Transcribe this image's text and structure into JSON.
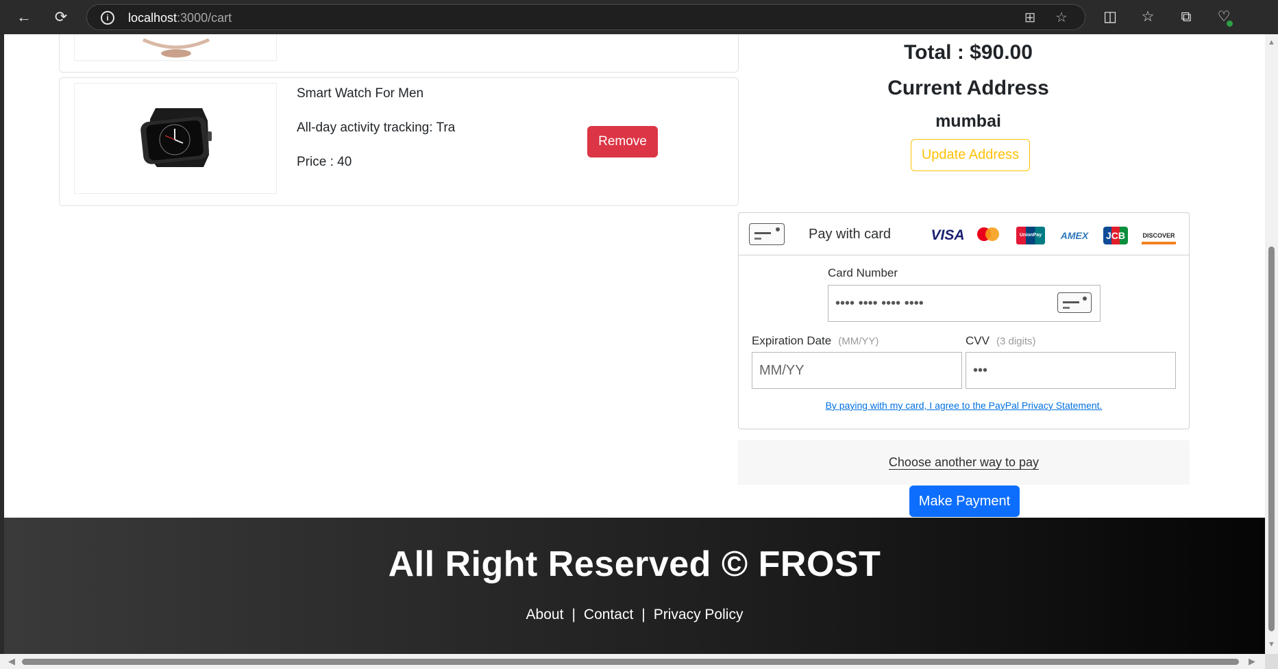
{
  "browser": {
    "url_host": "localhost",
    "url_path": ":3000/cart"
  },
  "cart": {
    "items": [
      {
        "name": "",
        "description": "",
        "price": ""
      },
      {
        "name": "Smart Watch For Men",
        "description": "All-day activity tracking: Tra",
        "price": "Price : 40",
        "remove_label": "Remove"
      }
    ]
  },
  "summary": {
    "total": "Total : $90.00",
    "address_title": "Current Address",
    "address": "mumbai",
    "update_label": "Update Address"
  },
  "payment": {
    "pay_with_card": "Pay with card",
    "brands": [
      "VISA",
      "mastercard",
      "UnionPay",
      "AMEX",
      "JCB",
      "DISCOVER"
    ],
    "card_number_label": "Card Number",
    "card_number_placeholder": "•••• •••• •••• ••••",
    "expiration_label": "Expiration Date",
    "expiration_hint": "(MM/YY)",
    "expiration_placeholder": "MM/YY",
    "cvv_label": "CVV",
    "cvv_hint": "(3 digits)",
    "cvv_placeholder": "•••",
    "agreement": "By paying with my card, I agree to the PayPal Privacy Statement.",
    "another_way": "Choose another way to pay",
    "make_payment": "Make Payment"
  },
  "footer": {
    "title": "All Right Reserved © FROST",
    "links": [
      "About",
      "Contact",
      "Privacy Policy"
    ],
    "separator": "|"
  },
  "colors": {
    "danger": "#dc3545",
    "warning": "#ffc107",
    "primary": "#0d6efd",
    "paypal_link": "#0070e0"
  }
}
